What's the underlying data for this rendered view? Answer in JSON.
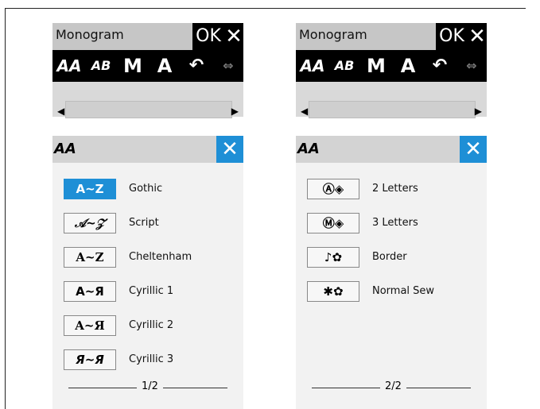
{
  "left_panel": {
    "title": "Monogram",
    "ok_label": "OK",
    "close_label": "✕",
    "toolbar": [
      {
        "name": "font-tool",
        "glyph": "AA"
      },
      {
        "name": "layout-tool",
        "glyph": "AB"
      },
      {
        "name": "size-tool",
        "glyph": "M"
      },
      {
        "name": "case-tool",
        "glyph": "A"
      },
      {
        "name": "rotate-tool",
        "glyph": "↶"
      },
      {
        "name": "spacing-tool",
        "glyph": "⇔"
      }
    ],
    "subheader_icon": "AA",
    "subheader_close": "✕",
    "items": [
      {
        "glyph": "A~Z",
        "label": "Gothic",
        "active": true
      },
      {
        "glyph": "𝒜~𝒵",
        "label": "Script",
        "active": false
      },
      {
        "glyph": "A~Z",
        "label": "Cheltenham",
        "active": false
      },
      {
        "glyph": "A~Я",
        "label": "Cyrillic 1",
        "active": false
      },
      {
        "glyph": "A~Я",
        "label": "Cyrillic 2",
        "active": false
      },
      {
        "glyph": "Я~Я",
        "label": "Cyrillic 3",
        "active": false
      }
    ],
    "page": "1/2"
  },
  "right_panel": {
    "title": "Monogram",
    "ok_label": "OK",
    "close_label": "✕",
    "subheader_icon": "AA",
    "subheader_close": "✕",
    "items": [
      {
        "glyph": "Ⓐ◈",
        "label": "2 Letters"
      },
      {
        "glyph": "Ⓜ◈",
        "label": "3 Letters"
      },
      {
        "glyph": "♪✿",
        "label": "Border"
      },
      {
        "glyph": "✱✿",
        "label": "Normal Sew"
      }
    ],
    "page": "2/2"
  }
}
